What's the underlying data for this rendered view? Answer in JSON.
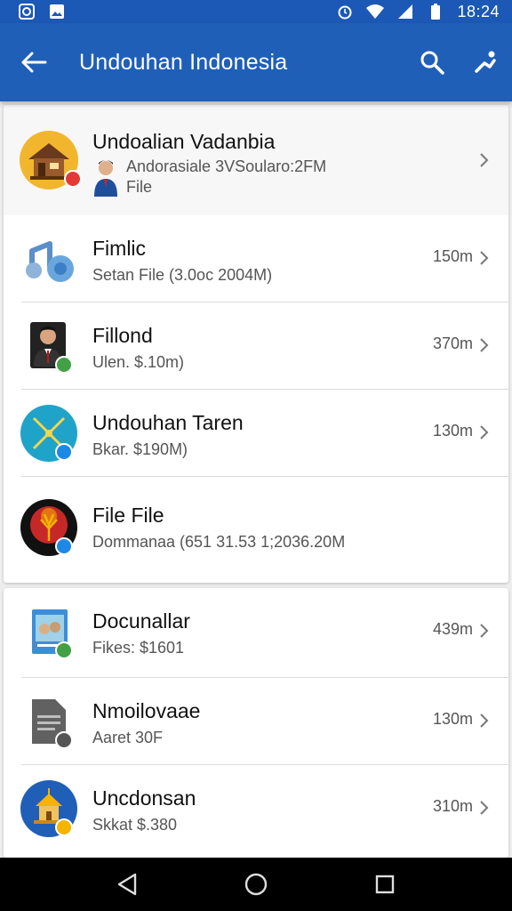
{
  "status_bar": {
    "time": "18:24",
    "icons": [
      "app-notification-icon",
      "image-notification-icon",
      "alarm-icon",
      "wifi-icon",
      "signal-icon",
      "battery-icon"
    ]
  },
  "app_bar": {
    "title": "Undouhan Indonesia",
    "color": "#1f5fb8",
    "icons": [
      "back-arrow-icon",
      "search-icon",
      "share-icon"
    ]
  },
  "items": [
    {
      "title": "Undoalian Vadanbia",
      "subtitle": "Andorasiale 3VSoularo:2FM",
      "subtitle2": "File",
      "size": "",
      "icon": "house-avatar-icon",
      "badge_color": "#e53935"
    },
    {
      "title": "Fimlic",
      "subtitle": "Setan File (3.0oc 2004M)",
      "size": "150m",
      "icon": "music-avatar-icon"
    },
    {
      "title": "Fillond",
      "subtitle": "Ulen. $.10m)",
      "size": "370m",
      "icon": "person-avatar-icon",
      "badge_color": "#43a047"
    },
    {
      "title": "Undouhan Taren",
      "subtitle": "Bkar. $190M)",
      "size": "130m",
      "icon": "star-avatar-icon",
      "badge_color": "#1e88e5"
    },
    {
      "title": "File File",
      "subtitle": "Dommanaa (651 31.53 1;2036.20M",
      "size": "",
      "icon": "tree-avatar-icon",
      "badge_color": "#1e88e5"
    },
    {
      "title": "Docunallar",
      "subtitle": "Fikes: $1601",
      "size": "439m",
      "icon": "photo-avatar-icon",
      "badge_color": "#43a047"
    },
    {
      "title": "Nmoilovaae",
      "subtitle": "Aaret 30F",
      "size": "130m",
      "icon": "document-avatar-icon",
      "badge_color": "#555555"
    },
    {
      "title": "Uncdonsan",
      "subtitle": "Skkat $.380",
      "size": "310m",
      "icon": "temple-avatar-icon",
      "badge_color": "#f5b400"
    }
  ],
  "nav_bar": {
    "icons": [
      "nav-back-icon",
      "nav-home-icon",
      "nav-recents-icon"
    ]
  }
}
